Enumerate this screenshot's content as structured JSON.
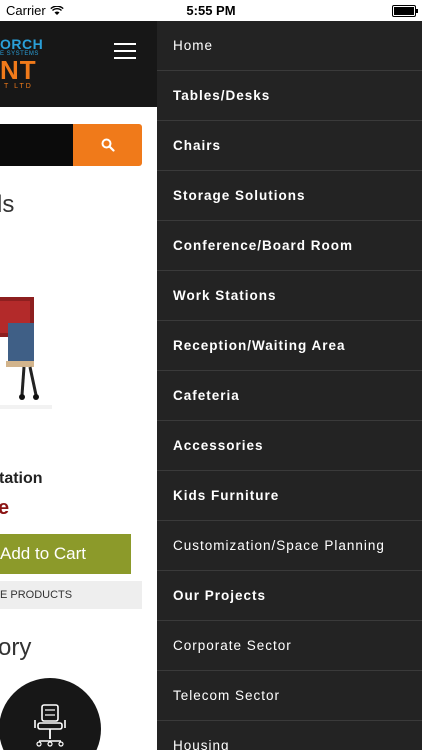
{
  "status_bar": {
    "carrier": "Carrier",
    "time": "5:55 PM"
  },
  "header": {
    "logo_top": "ORCH",
    "logo_sub": "E SYSTEMS",
    "logo_main": "NT",
    "logo_ltd": "T LTD"
  },
  "section": {
    "title": "ls"
  },
  "product": {
    "name": "tation",
    "price": "e",
    "add_to_cart": "Add to Cart"
  },
  "more_products": "E PRODUCTS",
  "category": {
    "title": "ory"
  },
  "menu": {
    "items": [
      {
        "label": "Home",
        "bold": false
      },
      {
        "label": "Tables/Desks",
        "bold": true
      },
      {
        "label": "Chairs",
        "bold": true
      },
      {
        "label": "Storage Solutions",
        "bold": true
      },
      {
        "label": "Conference/Board Room",
        "bold": true
      },
      {
        "label": "Work Stations",
        "bold": true
      },
      {
        "label": "Reception/Waiting Area",
        "bold": true
      },
      {
        "label": "Cafeteria",
        "bold": true
      },
      {
        "label": "Accessories",
        "bold": true
      },
      {
        "label": "Kids Furniture",
        "bold": true
      },
      {
        "label": "Customization/Space Planning",
        "bold": false
      },
      {
        "label": "Our Projects",
        "bold": true
      },
      {
        "label": "Corporate Sector",
        "bold": false
      },
      {
        "label": "Telecom Sector",
        "bold": false
      },
      {
        "label": "Housing",
        "bold": false
      }
    ]
  },
  "colors": {
    "accent_orange": "#f07a1a",
    "cart_green": "#8c9a2a",
    "drawer_bg": "#232323",
    "header_bg": "#171717",
    "price_red": "#8b1414"
  }
}
